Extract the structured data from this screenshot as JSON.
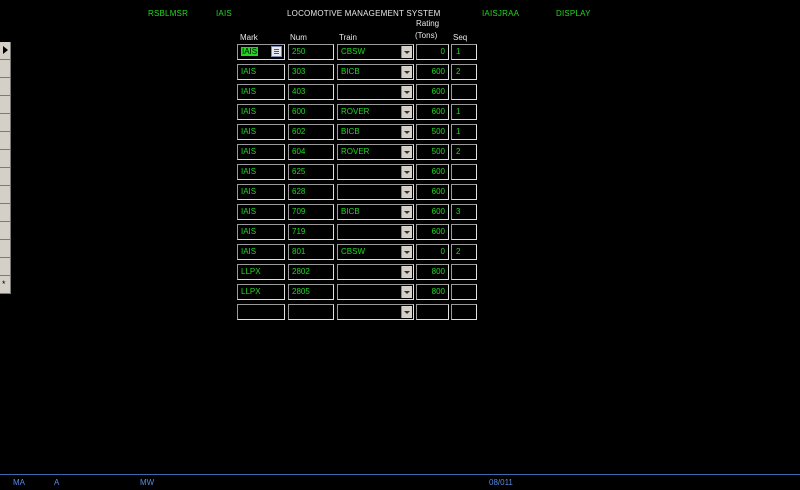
{
  "header": {
    "program": "RSBLMSR",
    "mark": "IAIS",
    "title": "LOCOMOTIVE MANAGEMENT SYSTEM",
    "user": "IAISJRAA",
    "mode": "DISPLAY"
  },
  "columns": {
    "mark": "Mark",
    "num": "Num",
    "train": "Train",
    "rating_line1": "Rating",
    "rating_line2": "(Tons)",
    "seq": "Seq"
  },
  "rows": [
    {
      "mark": "IAIS",
      "num": "250",
      "train": "CBSW",
      "rating": "0",
      "seq": "1"
    },
    {
      "mark": "IAIS",
      "num": "303",
      "train": "BICB",
      "rating": "600",
      "seq": "2"
    },
    {
      "mark": "IAIS",
      "num": "403",
      "train": "",
      "rating": "600",
      "seq": ""
    },
    {
      "mark": "IAIS",
      "num": "600",
      "train": "ROVER",
      "rating": "600",
      "seq": "1"
    },
    {
      "mark": "IAIS",
      "num": "602",
      "train": "BICB",
      "rating": "500",
      "seq": "1"
    },
    {
      "mark": "IAIS",
      "num": "604",
      "train": "ROVER",
      "rating": "500",
      "seq": "2"
    },
    {
      "mark": "IAIS",
      "num": "625",
      "train": "",
      "rating": "600",
      "seq": ""
    },
    {
      "mark": "IAIS",
      "num": "628",
      "train": "",
      "rating": "600",
      "seq": ""
    },
    {
      "mark": "IAIS",
      "num": "709",
      "train": "BICB",
      "rating": "600",
      "seq": "3"
    },
    {
      "mark": "IAIS",
      "num": "719",
      "train": "",
      "rating": "600",
      "seq": ""
    },
    {
      "mark": "IAIS",
      "num": "801",
      "train": "CBSW",
      "rating": "0",
      "seq": "2"
    },
    {
      "mark": "LLPX",
      "num": "2802",
      "train": "",
      "rating": "800",
      "seq": ""
    },
    {
      "mark": "LLPX",
      "num": "2805",
      "train": "",
      "rating": "800",
      "seq": ""
    }
  ],
  "new_row_marker": "*",
  "status": {
    "field1": "MA",
    "field2": "A",
    "field3": "MW",
    "record_counter": "08/011"
  },
  "colors": {
    "text_green": "#20d820",
    "background": "#000000",
    "status_blue": "#5a8ae0"
  }
}
